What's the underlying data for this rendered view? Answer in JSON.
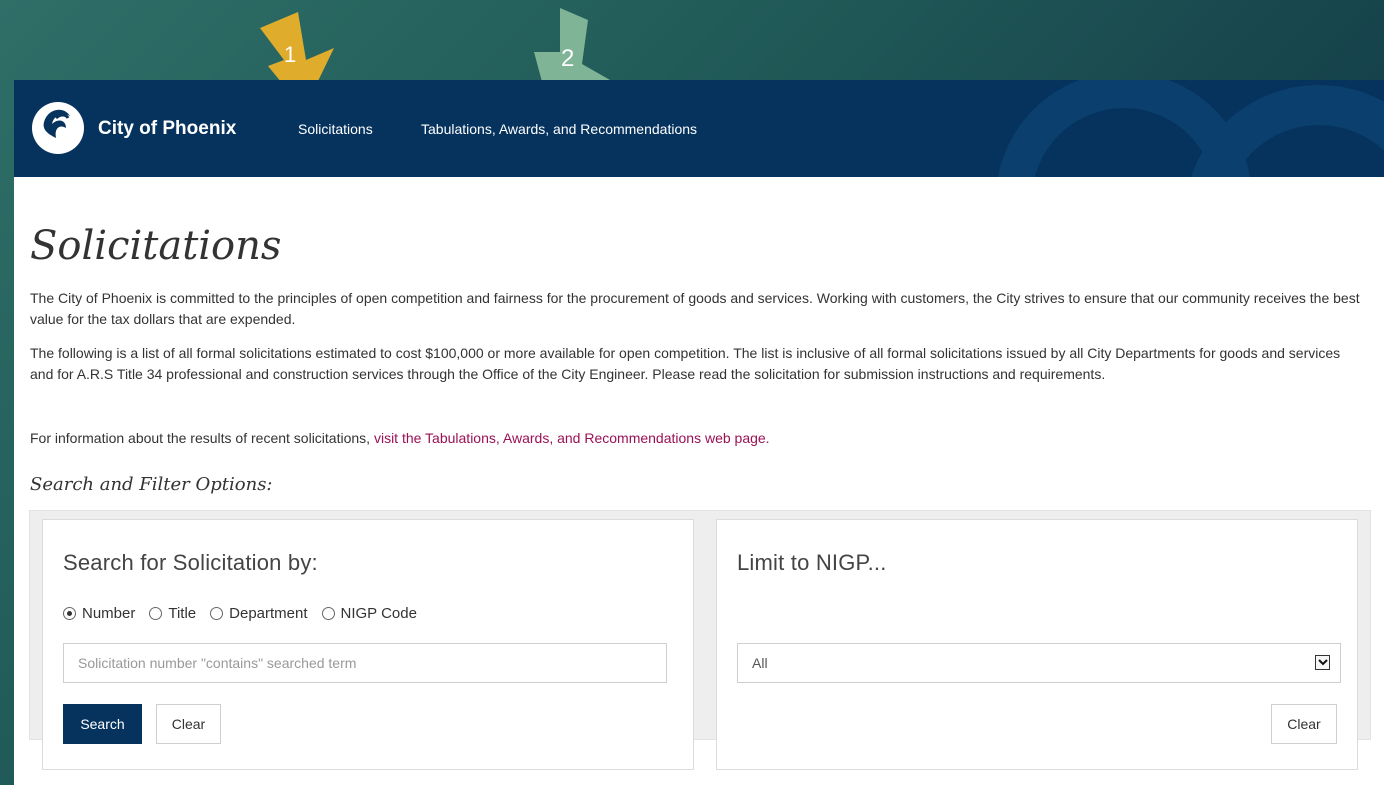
{
  "header": {
    "brand": "City of Phoenix",
    "nav": [
      {
        "label": "Solicitations"
      },
      {
        "label": "Tabulations, Awards, and Recommendations"
      }
    ]
  },
  "callouts": {
    "arrow1_number": "1",
    "arrow2_number": "2",
    "arrow1_color": "#e0ac2c",
    "arrow2_color": "#7fb596"
  },
  "page": {
    "title": "Solicitations",
    "paragraph1": "The City of Phoenix is committed to the principles of open competition and fairness for the procurement of goods and services. Working with customers, the City strives to ensure that our community receives the best value for the tax dollars that are expended.",
    "paragraph2": "The following is a list of all formal solicitations estimated to cost $100,000 or more available for open competition. The list is inclusive of all formal solicitations issued by all City Departments for goods and services and for A.R.S Title 34 professional and construction services through the Office of the City Engineer. Please read the solicitation for submission instructions and requirements.",
    "paragraph3_text": "For information about the results of recent solicitations, ",
    "paragraph3_link": "visit the Tabulations, Awards, and Recommendations web page.",
    "filter_heading": "Search and Filter Options:"
  },
  "search_panel": {
    "title": "Search for Solicitation by:",
    "options": [
      {
        "label": "Number",
        "checked": true
      },
      {
        "label": "Title",
        "checked": false
      },
      {
        "label": "Department",
        "checked": false
      },
      {
        "label": "NIGP Code",
        "checked": false
      }
    ],
    "input_value": "",
    "input_placeholder": "Solicitation number \"contains\" searched term",
    "search_label": "Search",
    "clear_label": "Clear"
  },
  "nigp_panel": {
    "title": "Limit to NIGP...",
    "selected": "All",
    "clear_label": "Clear"
  },
  "colors": {
    "navbar": "#06335e",
    "link": "#9b1156",
    "primary_button": "#06335e"
  }
}
